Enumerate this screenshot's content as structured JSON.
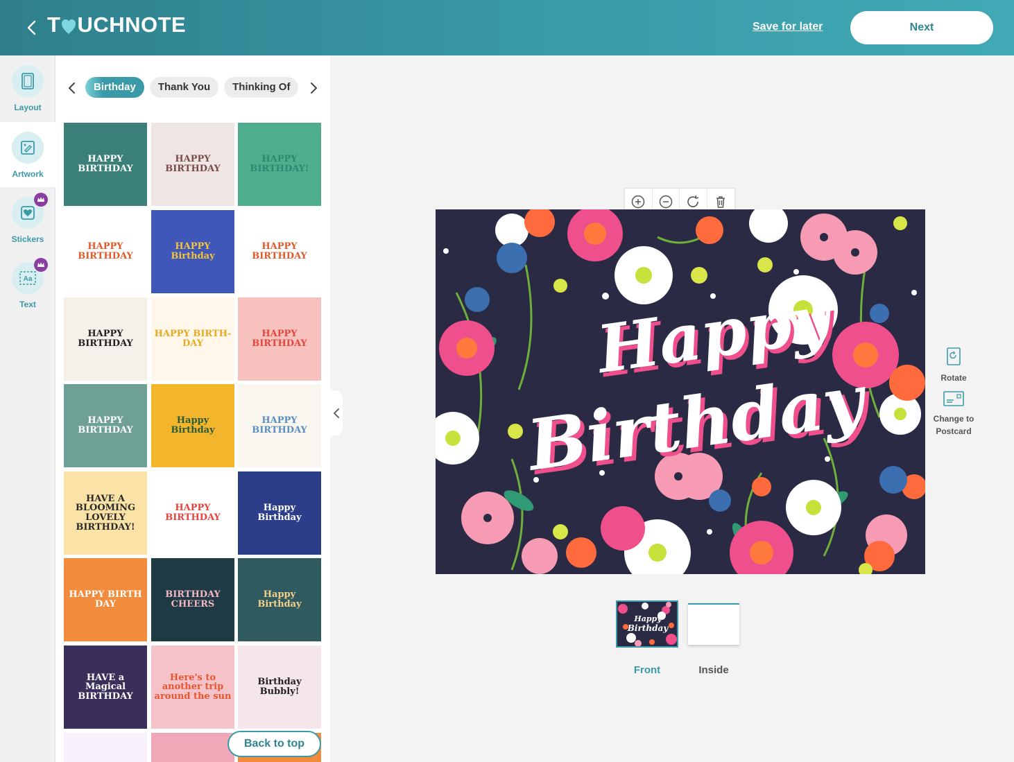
{
  "header": {
    "logo_text_left": "T",
    "logo_text_right": "UCHNOTE",
    "save_later_label": "Save for later",
    "next_label": "Next"
  },
  "rail": {
    "tools": [
      {
        "label": "Layout",
        "icon": "layout-icon"
      },
      {
        "label": "Artwork",
        "icon": "artwork-icon"
      },
      {
        "label": "Stickers",
        "icon": "stickers-icon"
      },
      {
        "label": "Text",
        "icon": "text-icon"
      }
    ]
  },
  "panel": {
    "tabs": [
      "Birthday",
      "Thank You",
      "Thinking Of"
    ],
    "back_to_top_label": "Back to top",
    "thumbs": [
      {
        "text": "HAPPY BIRTHDAY",
        "bg": "#3a7f78",
        "fg": "#ffffff"
      },
      {
        "text": "HAPPY BIRTHDAY",
        "bg": "#efe6e4",
        "fg": "#7a4b4b"
      },
      {
        "text": "HAPPY BIRTHDAY!",
        "bg": "#4fae8e",
        "fg": "#2a8a6f"
      },
      {
        "text": "HAPPY BIRTHDAY",
        "bg": "#ffffff",
        "fg": "#e05a2b"
      },
      {
        "text": "HAPPY Birthday",
        "bg": "#3f57b8",
        "fg": "#f6c33a"
      },
      {
        "text": "HAPPY BIRTHDAY",
        "bg": "#ffffff",
        "fg": "#e05a2b"
      },
      {
        "text": "HAPPY BIRTHDAY",
        "bg": "#f5f0ea",
        "fg": "#222222"
      },
      {
        "text": "HAPPY BIRTH-DAY",
        "bg": "#fff8ea",
        "fg": "#e8a920"
      },
      {
        "text": "HAPPY BIRTHDAY",
        "bg": "#f7c2bd",
        "fg": "#e2463f"
      },
      {
        "text": "HAPPY BIRTHDAY",
        "bg": "#6fa095",
        "fg": "#ffffff"
      },
      {
        "text": "Happy Birthday",
        "bg": "#f2b52b",
        "fg": "#2a5a3a"
      },
      {
        "text": "HAPPY BIRTHDAY",
        "bg": "#f8f6ee",
        "fg": "#5b8fc2"
      },
      {
        "text": "HAVE A BLOOMING LOVELY BIRTHDAY!",
        "bg": "#fbe3a8",
        "fg": "#2a2a2a"
      },
      {
        "text": "HAPPY BIRTHDAY",
        "bg": "#ffffff",
        "fg": "#e2463f"
      },
      {
        "text": "Happy Birthday",
        "bg": "#2c3e8a",
        "fg": "#ffffff"
      },
      {
        "text": "HAPPY BIRTH DAY",
        "bg": "#f28c3c",
        "fg": "#ffffff"
      },
      {
        "text": "BIRTHDAY CHEERS",
        "bg": "#1e3a44",
        "fg": "#f4b6c0"
      },
      {
        "text": "Happy Birthday",
        "bg": "#2f5a60",
        "fg": "#f4d08a"
      },
      {
        "text": "HAVE a Magical BIRTHDAY",
        "bg": "#3a2f5a",
        "fg": "#ffffff"
      },
      {
        "text": "Here's to another trip around the sun",
        "bg": "#f4c2c8",
        "fg": "#e8562b"
      },
      {
        "text": "Birthday Bubbly!",
        "bg": "#f4e6ea",
        "fg": "#222222"
      },
      {
        "text": "",
        "bg": "#f7f2fb",
        "fg": "#222222"
      },
      {
        "text": "",
        "bg": "#f2a7b8",
        "fg": "#222222"
      },
      {
        "text": "",
        "bg": "#f28c3c",
        "fg": "#222222"
      }
    ]
  },
  "canvas": {
    "card_line1": "Happy",
    "card_line2": "Birthday",
    "toolbar": [
      "zoom-in-icon",
      "zoom-out-icon",
      "rotate-icon",
      "trash-icon"
    ]
  },
  "side_actions": {
    "rotate_label": "Rotate",
    "change_line1": "Change to",
    "change_line2": "Postcard"
  },
  "pages": {
    "front_label": "Front",
    "inside_label": "Inside",
    "front_thumb_line1": "Happy",
    "front_thumb_line2": "Birthday"
  },
  "colors": {
    "accent": "#3a9aa8",
    "accent_dark": "#2d8593",
    "card_bg": "#2b2a44",
    "premium": "#8a3fa0"
  }
}
